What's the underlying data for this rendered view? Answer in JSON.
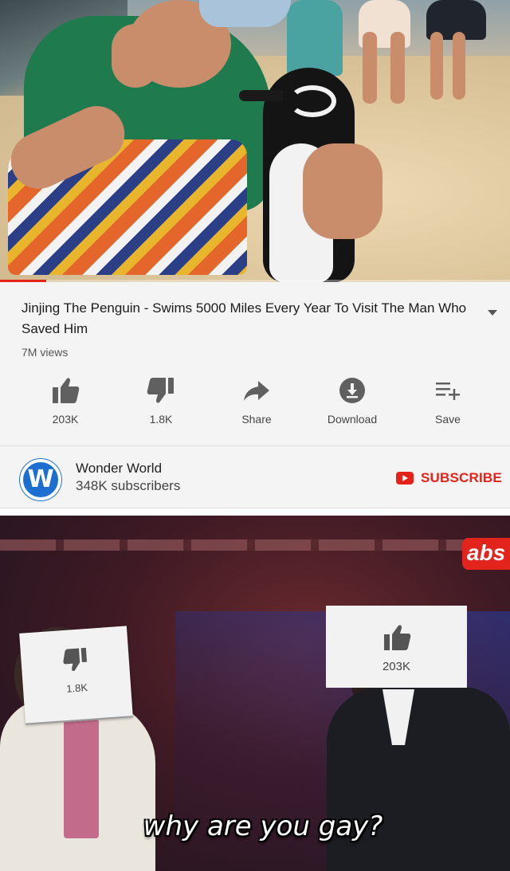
{
  "video": {
    "title": "Jinjing The Penguin - Swims 5000 Miles Every Year To Visit The Man Who Saved Him",
    "views": "7M views",
    "progress_fraction": 0.09
  },
  "actions": [
    {
      "label": "203K",
      "icon": "thumbs-up-icon"
    },
    {
      "label": "1.8K",
      "icon": "thumbs-down-icon"
    },
    {
      "label": "Share",
      "icon": "share-arrow-icon"
    },
    {
      "label": "Download",
      "icon": "download-icon"
    },
    {
      "label": "Save",
      "icon": "playlist-add-icon"
    }
  ],
  "channel": {
    "name": "Wonder World",
    "subscribers": "348K subscribers",
    "avatar_letter": "W",
    "subscribe_label": "SUBSCRIBE"
  },
  "meme": {
    "network_logo": "abs",
    "dislike_card": {
      "count": "1.8K"
    },
    "like_card": {
      "count": "203K"
    },
    "caption": "why are you gay?"
  },
  "colors": {
    "accent_red": "#e62117",
    "panel_bg": "#f4f4f4",
    "text_dark": "#1b1b1b",
    "avatar_blue": "#1c6fd0"
  }
}
